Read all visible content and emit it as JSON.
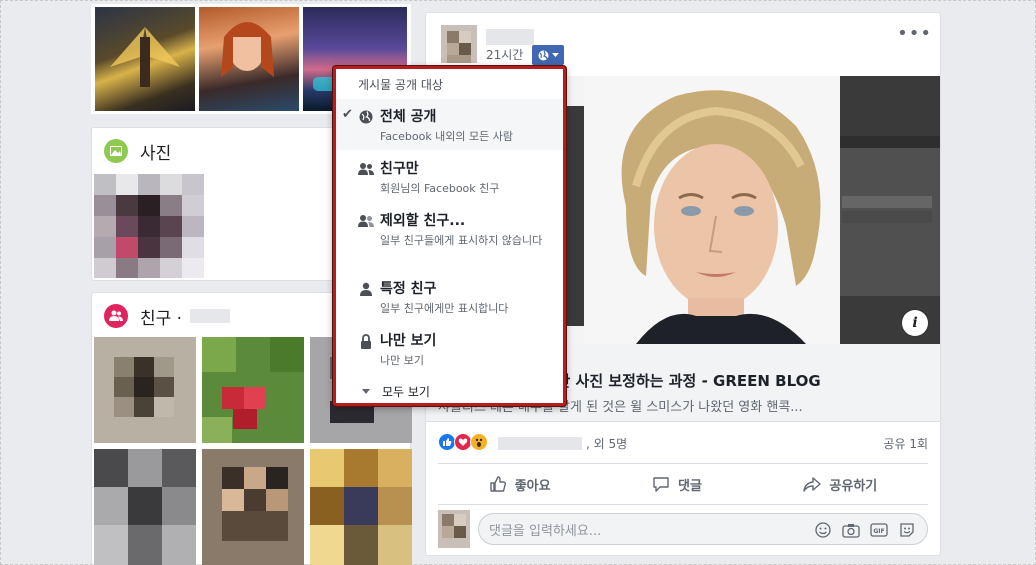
{
  "post": {
    "time": "21시간",
    "link_title": "샤를리즈 테론 - 일반 사진 보정하는 과정 - GREEN BLOG",
    "link_desc": "샤를리즈 테론 배우를 알게 된 것은 윌 스미스가 나왔던 영화 핸콕...",
    "reactors_more": ", 외 5명",
    "share_count": "공유 1회",
    "actions": {
      "like": "좋아요",
      "comment": "댓글",
      "share": "공유하기"
    },
    "comment_placeholder": "댓글을 입력하세요...",
    "info_label": "i",
    "more_label": "•••"
  },
  "sidebar": {
    "photos_title": "사진",
    "friends_title": "친구 ·"
  },
  "audience_menu": {
    "header": "게시물 공개 대상",
    "options": [
      {
        "title": "전체 공개",
        "subtitle": "Facebook 내외의 모든 사람",
        "icon": "globe-icon",
        "selected": true
      },
      {
        "title": "친구만",
        "subtitle": "회원님의 Facebook 친구",
        "icon": "friends-icon",
        "selected": false
      },
      {
        "title": "제외할 친구...",
        "subtitle": "일부 친구들에게 표시하지 않습니다",
        "icon": "friends-except-icon",
        "selected": false
      },
      {
        "title": "특정 친구",
        "subtitle": "일부 친구에게만 표시합니다",
        "icon": "person-icon",
        "selected": false
      },
      {
        "title": "나만 보기",
        "subtitle": "나만 보기",
        "icon": "lock-icon",
        "selected": false
      }
    ],
    "see_all": "모두 보기"
  },
  "colors": {
    "facebook_blue": "#4267b2",
    "highlight_border": "#b41e1e",
    "photos_icon_green": "#8fc952",
    "friends_icon_pink": "#e0245e"
  }
}
